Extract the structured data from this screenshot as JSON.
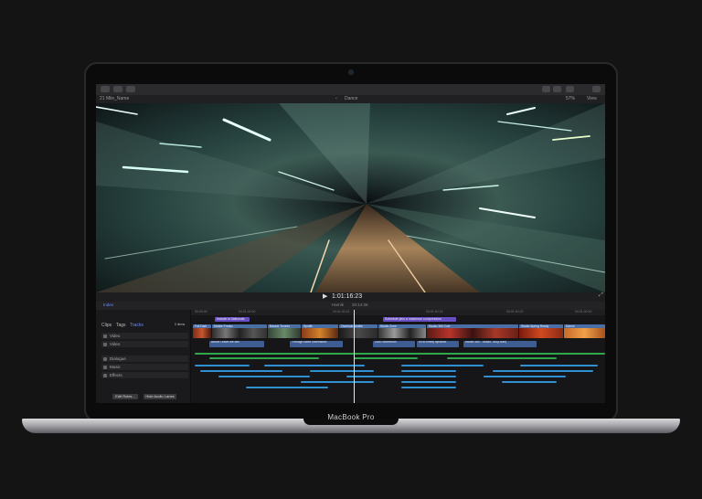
{
  "device": {
    "brand": "MacBook Pro"
  },
  "toolbar": {
    "library_name": "21 Mile_Name",
    "viewer_title": "Dance",
    "zoom": "57%",
    "view_label": "View"
  },
  "viewer": {
    "timecode": "1:01:16:23"
  },
  "timeline_header": {
    "project_name": "Harnik",
    "duration": "20:14:26"
  },
  "timecode_ruler": [
    "00:00:00",
    "00:01:00:00",
    "00:01:00:15",
    "00:01:00:15",
    "00:01:00:20",
    "00:01:00:20"
  ],
  "library": {
    "tabs": [
      "Clips",
      "Tags",
      "Tracks"
    ],
    "count_label": "0 items",
    "rows": [
      "Video",
      "Video",
      "Dialogue",
      "Music",
      "Effects"
    ],
    "edit_roles_button": "Edit Roles...",
    "hide_audio_lanes_button": "Hide Audio Lanes"
  },
  "timeline": {
    "upper_chips": [
      "Include in Nationals",
      "Schedule plus a maximum compression"
    ],
    "clips": [
      "Full Dark",
      "Mobile Freaks",
      "Barack Toronto",
      "Spotlik",
      "Overlook Mobile",
      "Studio Zone",
      "Studio 360 Cole",
      "Studio Spring Ready",
      "Dance"
    ],
    "connected": [
      "Above Leave the Mill",
      "Through some information",
      "2020 Stormborn",
      "00 to ninety dynamic",
      "Studio 360 - Studio, Stu(Loom)"
    ]
  },
  "colors": {
    "accent_blue": "#2c4f7e",
    "audio_green": "#2ea84a",
    "audio_blue": "#2f8fd0",
    "chip_purple": "#6a4fc4"
  }
}
